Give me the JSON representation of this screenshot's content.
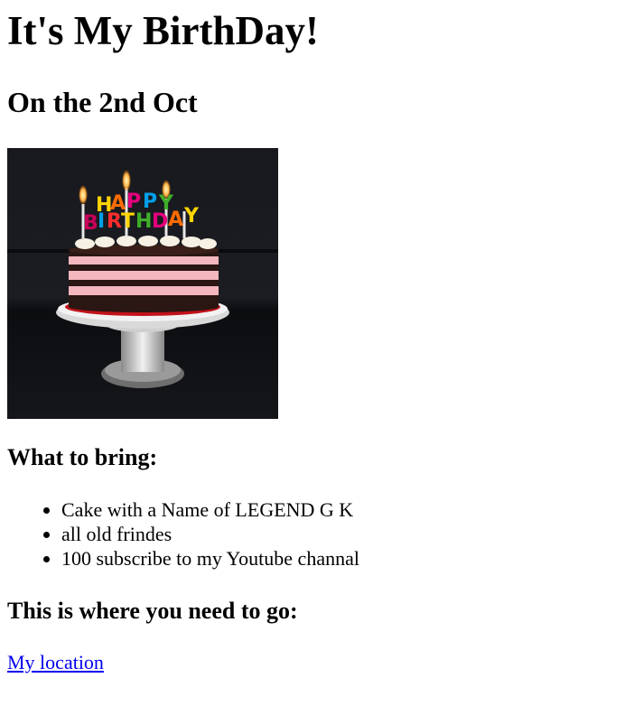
{
  "page": {
    "title": "It's My BirthDay!",
    "subtitle": "On the 2nd Oct"
  },
  "image": {
    "description_icon": "birthday-cake-image",
    "candle_letters": "HAPPY BIRTHDAY"
  },
  "bring": {
    "heading": "What to bring:",
    "items": [
      "Cake with a Name of LEGEND G K",
      "all old frindes",
      "100 subscribe to my Youtube channal"
    ]
  },
  "location": {
    "heading": "This is where you need to go:",
    "link_text": "My location"
  },
  "colors": {
    "link": "#0000ee",
    "text": "#000000",
    "background": "#ffffff"
  }
}
